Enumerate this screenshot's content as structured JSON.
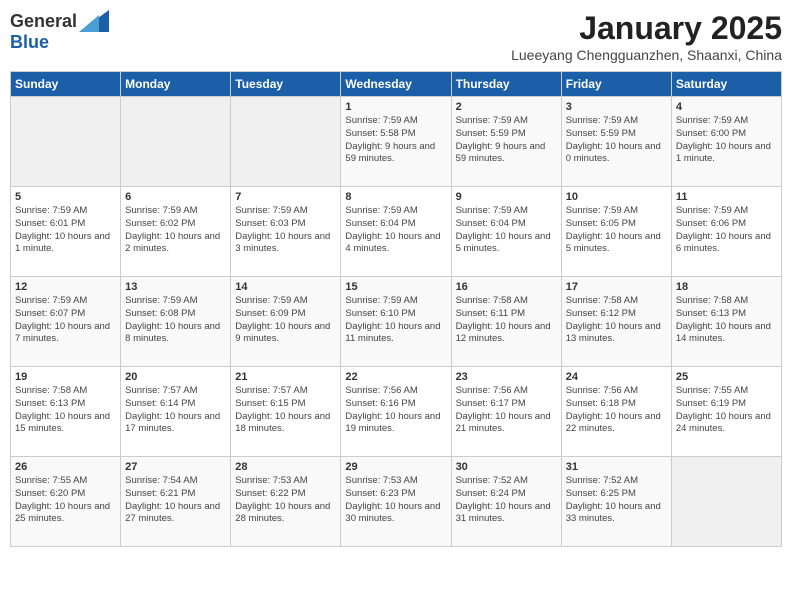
{
  "header": {
    "logo_general": "General",
    "logo_blue": "Blue",
    "title": "January 2025",
    "subtitle": "Lueeyang Chengguanzhen, Shaanxi, China"
  },
  "weekdays": [
    "Sunday",
    "Monday",
    "Tuesday",
    "Wednesday",
    "Thursday",
    "Friday",
    "Saturday"
  ],
  "weeks": [
    [
      {
        "day": "",
        "info": ""
      },
      {
        "day": "",
        "info": ""
      },
      {
        "day": "",
        "info": ""
      },
      {
        "day": "1",
        "info": "Sunrise: 7:59 AM\nSunset: 5:58 PM\nDaylight: 9 hours and 59 minutes."
      },
      {
        "day": "2",
        "info": "Sunrise: 7:59 AM\nSunset: 5:59 PM\nDaylight: 9 hours and 59 minutes."
      },
      {
        "day": "3",
        "info": "Sunrise: 7:59 AM\nSunset: 5:59 PM\nDaylight: 10 hours and 0 minutes."
      },
      {
        "day": "4",
        "info": "Sunrise: 7:59 AM\nSunset: 6:00 PM\nDaylight: 10 hours and 1 minute."
      }
    ],
    [
      {
        "day": "5",
        "info": "Sunrise: 7:59 AM\nSunset: 6:01 PM\nDaylight: 10 hours and 1 minute."
      },
      {
        "day": "6",
        "info": "Sunrise: 7:59 AM\nSunset: 6:02 PM\nDaylight: 10 hours and 2 minutes."
      },
      {
        "day": "7",
        "info": "Sunrise: 7:59 AM\nSunset: 6:03 PM\nDaylight: 10 hours and 3 minutes."
      },
      {
        "day": "8",
        "info": "Sunrise: 7:59 AM\nSunset: 6:04 PM\nDaylight: 10 hours and 4 minutes."
      },
      {
        "day": "9",
        "info": "Sunrise: 7:59 AM\nSunset: 6:04 PM\nDaylight: 10 hours and 5 minutes."
      },
      {
        "day": "10",
        "info": "Sunrise: 7:59 AM\nSunset: 6:05 PM\nDaylight: 10 hours and 5 minutes."
      },
      {
        "day": "11",
        "info": "Sunrise: 7:59 AM\nSunset: 6:06 PM\nDaylight: 10 hours and 6 minutes."
      }
    ],
    [
      {
        "day": "12",
        "info": "Sunrise: 7:59 AM\nSunset: 6:07 PM\nDaylight: 10 hours and 7 minutes."
      },
      {
        "day": "13",
        "info": "Sunrise: 7:59 AM\nSunset: 6:08 PM\nDaylight: 10 hours and 8 minutes."
      },
      {
        "day": "14",
        "info": "Sunrise: 7:59 AM\nSunset: 6:09 PM\nDaylight: 10 hours and 9 minutes."
      },
      {
        "day": "15",
        "info": "Sunrise: 7:59 AM\nSunset: 6:10 PM\nDaylight: 10 hours and 11 minutes."
      },
      {
        "day": "16",
        "info": "Sunrise: 7:58 AM\nSunset: 6:11 PM\nDaylight: 10 hours and 12 minutes."
      },
      {
        "day": "17",
        "info": "Sunrise: 7:58 AM\nSunset: 6:12 PM\nDaylight: 10 hours and 13 minutes."
      },
      {
        "day": "18",
        "info": "Sunrise: 7:58 AM\nSunset: 6:13 PM\nDaylight: 10 hours and 14 minutes."
      }
    ],
    [
      {
        "day": "19",
        "info": "Sunrise: 7:58 AM\nSunset: 6:13 PM\nDaylight: 10 hours and 15 minutes."
      },
      {
        "day": "20",
        "info": "Sunrise: 7:57 AM\nSunset: 6:14 PM\nDaylight: 10 hours and 17 minutes."
      },
      {
        "day": "21",
        "info": "Sunrise: 7:57 AM\nSunset: 6:15 PM\nDaylight: 10 hours and 18 minutes."
      },
      {
        "day": "22",
        "info": "Sunrise: 7:56 AM\nSunset: 6:16 PM\nDaylight: 10 hours and 19 minutes."
      },
      {
        "day": "23",
        "info": "Sunrise: 7:56 AM\nSunset: 6:17 PM\nDaylight: 10 hours and 21 minutes."
      },
      {
        "day": "24",
        "info": "Sunrise: 7:56 AM\nSunset: 6:18 PM\nDaylight: 10 hours and 22 minutes."
      },
      {
        "day": "25",
        "info": "Sunrise: 7:55 AM\nSunset: 6:19 PM\nDaylight: 10 hours and 24 minutes."
      }
    ],
    [
      {
        "day": "26",
        "info": "Sunrise: 7:55 AM\nSunset: 6:20 PM\nDaylight: 10 hours and 25 minutes."
      },
      {
        "day": "27",
        "info": "Sunrise: 7:54 AM\nSunset: 6:21 PM\nDaylight: 10 hours and 27 minutes."
      },
      {
        "day": "28",
        "info": "Sunrise: 7:53 AM\nSunset: 6:22 PM\nDaylight: 10 hours and 28 minutes."
      },
      {
        "day": "29",
        "info": "Sunrise: 7:53 AM\nSunset: 6:23 PM\nDaylight: 10 hours and 30 minutes."
      },
      {
        "day": "30",
        "info": "Sunrise: 7:52 AM\nSunset: 6:24 PM\nDaylight: 10 hours and 31 minutes."
      },
      {
        "day": "31",
        "info": "Sunrise: 7:52 AM\nSunset: 6:25 PM\nDaylight: 10 hours and 33 minutes."
      },
      {
        "day": "",
        "info": ""
      }
    ]
  ]
}
